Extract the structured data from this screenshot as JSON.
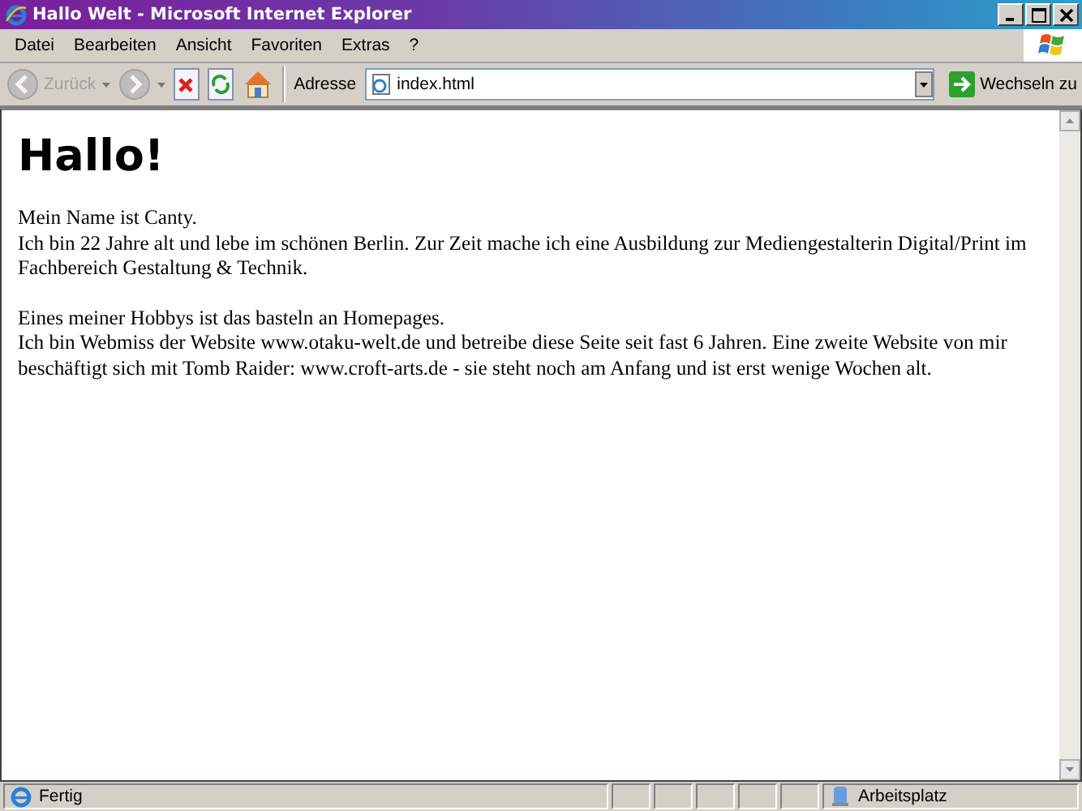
{
  "window": {
    "title": "Hallo Welt - Microsoft Internet Explorer"
  },
  "menu": [
    "Datei",
    "Bearbeiten",
    "Ansicht",
    "Favoriten",
    "Extras",
    "?"
  ],
  "toolbar": {
    "back": {
      "label": "Zurück",
      "disabled": true
    },
    "forward": {
      "disabled": true
    }
  },
  "address": {
    "label": "Adresse",
    "value": "index.html",
    "go": "Wechseln zu"
  },
  "page": {
    "heading": "Hallo!",
    "paragraphs": [
      [
        "Mein Name ist Canty.",
        "Ich bin 22 Jahre alt und lebe im schönen Berlin. Zur Zeit mache ich eine Ausbildung zur Mediengestalterin Digital/Print im Fachbereich Gestaltung & Technik."
      ],
      [
        "Eines meiner Hobbys ist das basteln an Homepages.",
        "Ich bin Webmiss der Website www.otaku-welt.de und betreibe diese Seite seit fast 6 Jahren. Eine zweite Website von mir beschäftigt sich mit Tomb Raider: www.croft-arts.de - sie steht noch am Anfang und ist erst wenige Wochen alt."
      ]
    ]
  },
  "status_bar": {
    "text": "Fertig",
    "zone": "Arbeitsplatz"
  }
}
